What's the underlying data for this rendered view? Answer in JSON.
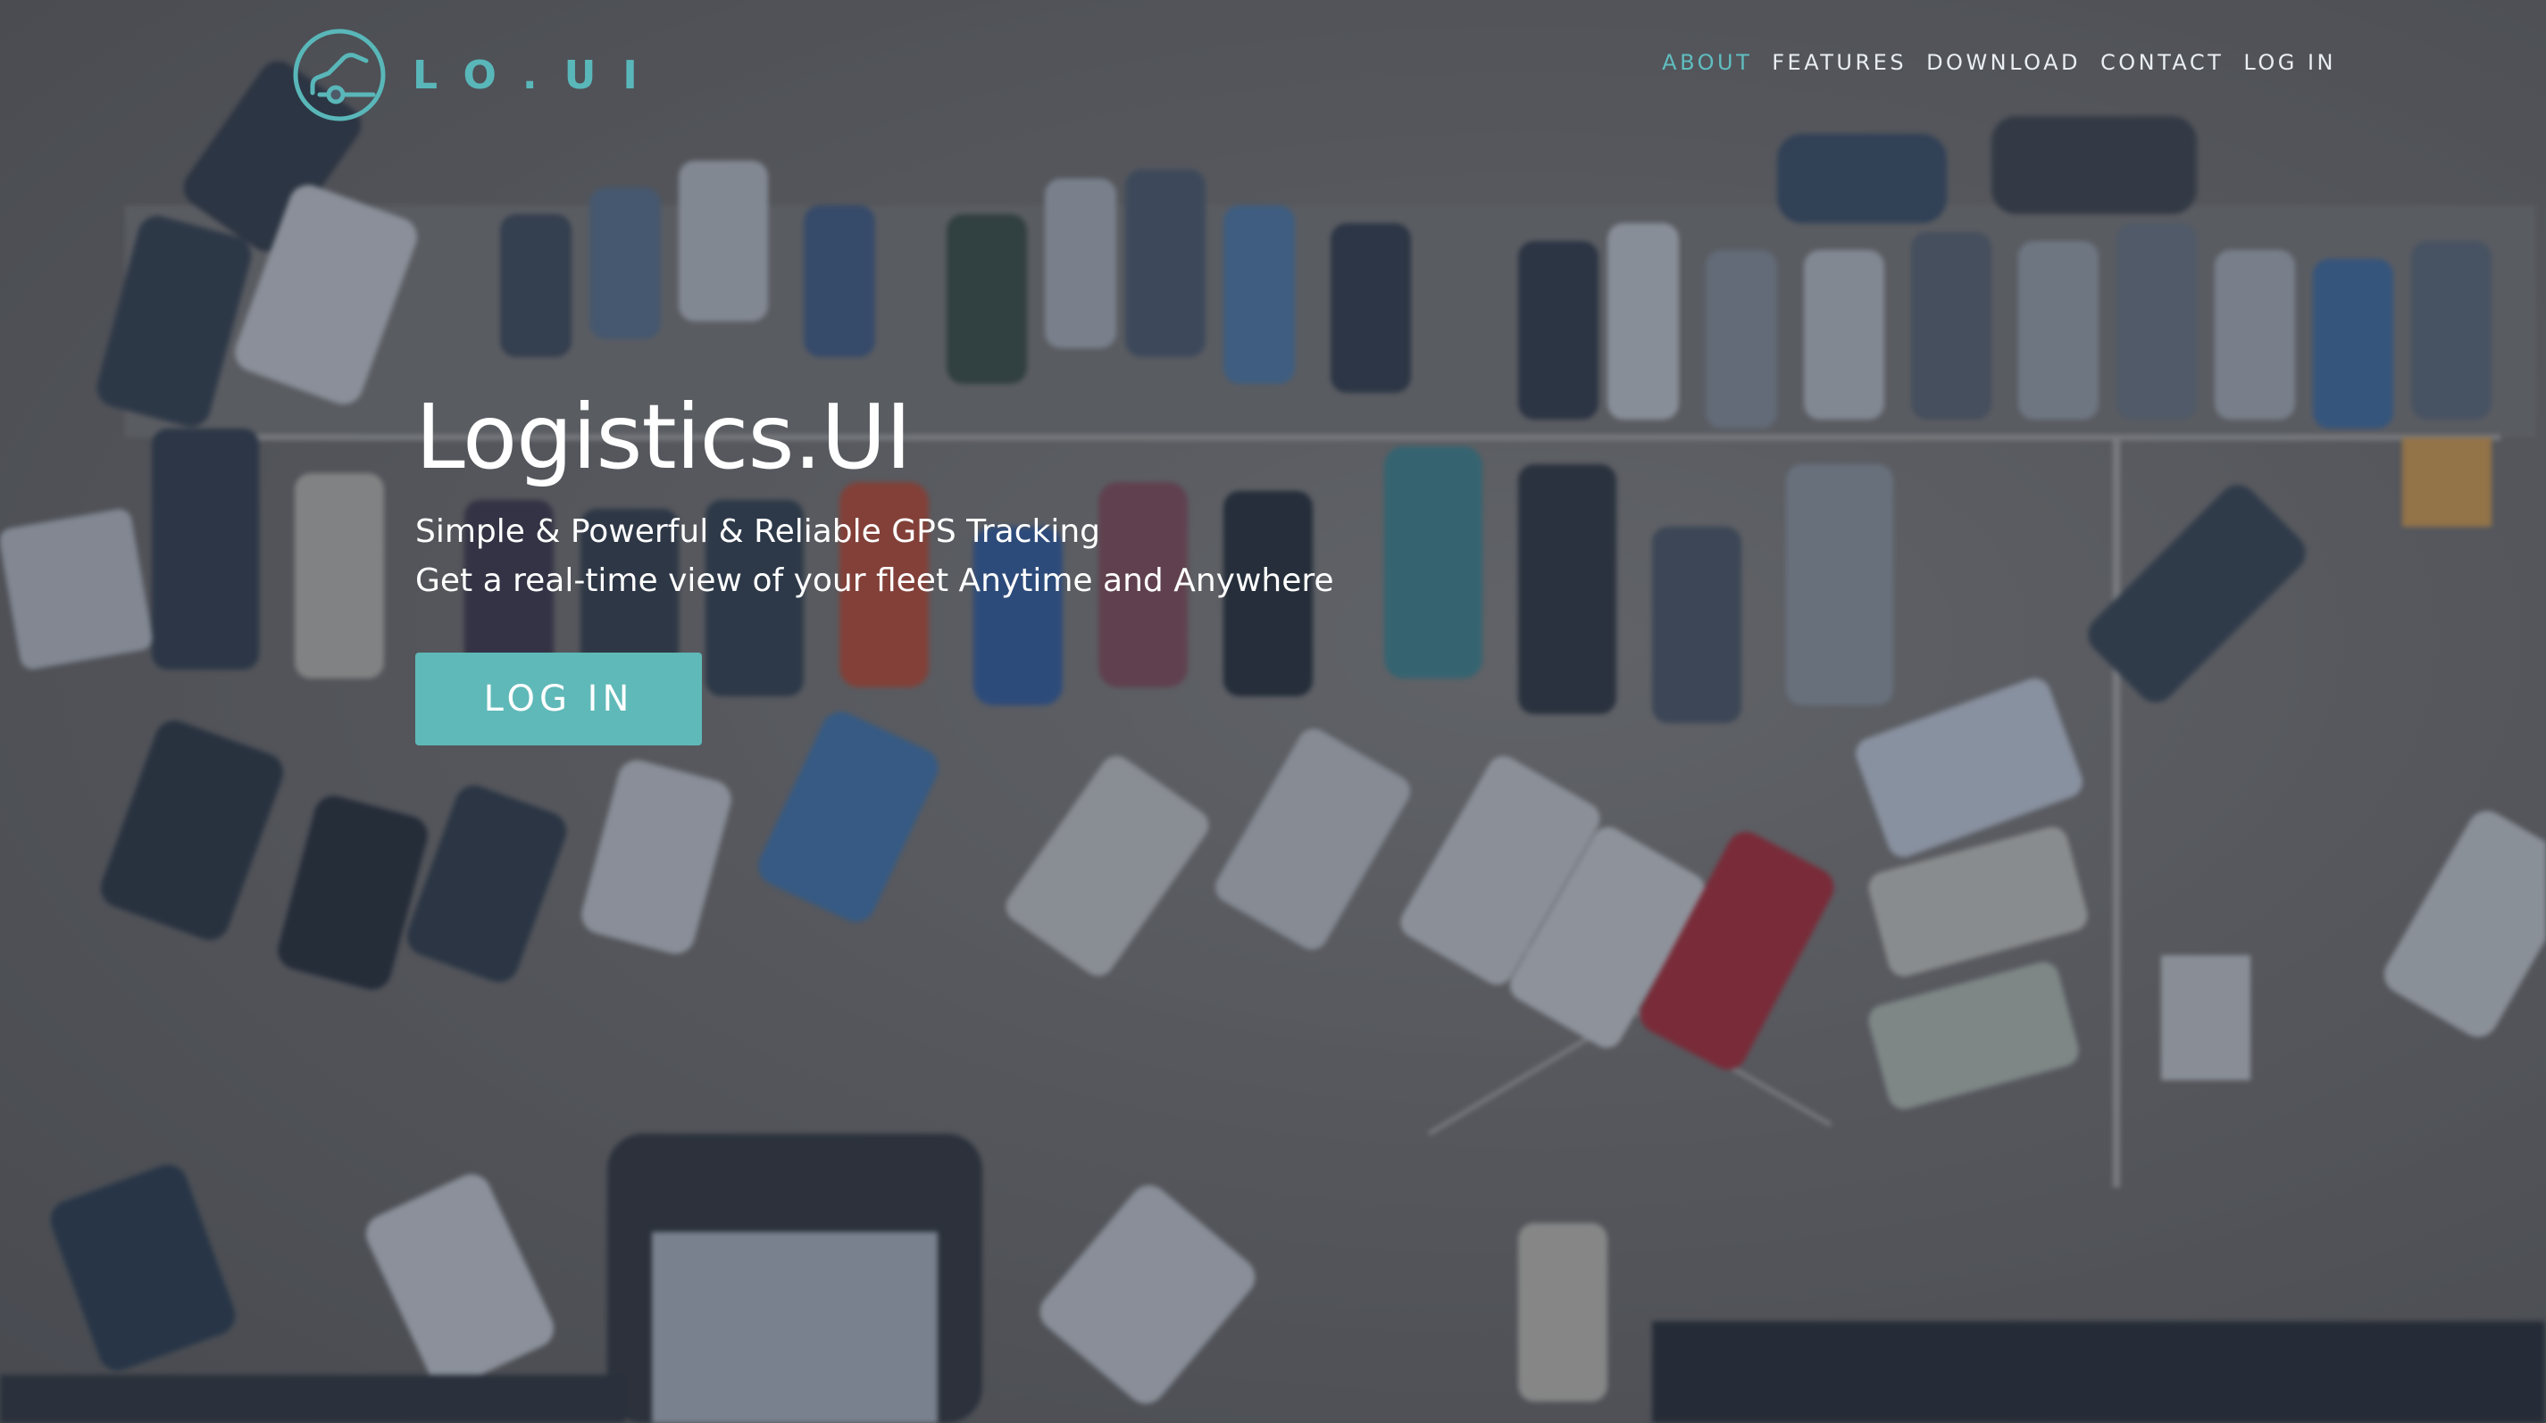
{
  "brand": {
    "logo_text": "LO.UI",
    "accent_color": "#5fb9b8",
    "logo_icon": "car-circle-icon"
  },
  "nav": {
    "items": [
      {
        "label": "ABOUT",
        "active": true
      },
      {
        "label": "FEATURES",
        "active": false
      },
      {
        "label": "DOWNLOAD",
        "active": false
      },
      {
        "label": "CONTACT",
        "active": false
      },
      {
        "label": "LOG IN",
        "active": false
      }
    ]
  },
  "hero": {
    "title": "Logistics.UI",
    "subtitle_line1": "Simple & Powerful & Reliable GPS Tracking",
    "subtitle_line2": "Get a real-time view of your fleet Anytime and Anywhere",
    "cta_label": "LOG IN",
    "background": "aerial-parking-lot-photo"
  }
}
